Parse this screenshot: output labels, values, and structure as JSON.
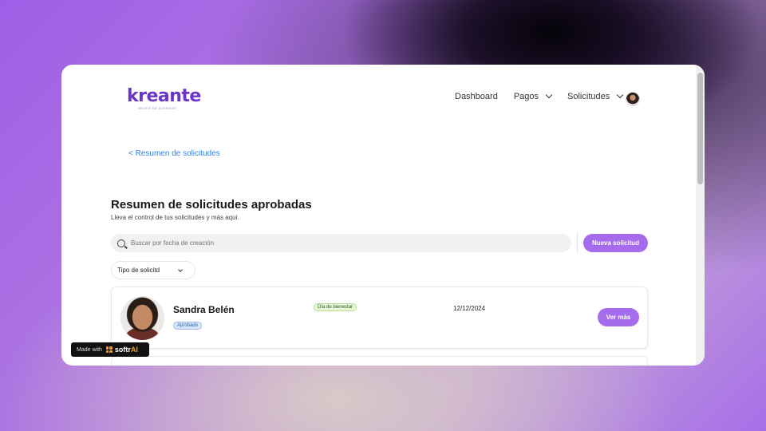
{
  "header": {
    "logo_text": "kreante",
    "logo_tagline": "NEVER BE AVERAGE",
    "nav": [
      {
        "label": "Dashboard",
        "has_dropdown": false
      },
      {
        "label": "Pagos",
        "has_dropdown": true
      },
      {
        "label": "Solicitudes",
        "has_dropdown": true
      }
    ]
  },
  "breadcrumb": "< Resumen de solicitudes",
  "page": {
    "title": "Resumen de solicitudes aprobadas",
    "subtitle": "Lleva el control de tus solicitudes y más aquí."
  },
  "search": {
    "placeholder": "Buscar por fecha de creación",
    "value": ""
  },
  "new_button_label": "Nueva solicitud",
  "filter": {
    "label": "Tipo de solicitd"
  },
  "requests": [
    {
      "name": "Sandra Belén",
      "status": "Aprobado",
      "type": "Día de bienestar",
      "date": "12/12/2024",
      "action_label": "Ver más"
    }
  ],
  "footer_badge": {
    "made_with": "Made with",
    "brand_prefix": "softr",
    "brand_suffix": "AI"
  },
  "colors": {
    "accent": "#a66bed",
    "link": "#2f80ed",
    "status_approved_bg": "#d8e6fb",
    "type_badge_bg": "#e6f7d8"
  }
}
